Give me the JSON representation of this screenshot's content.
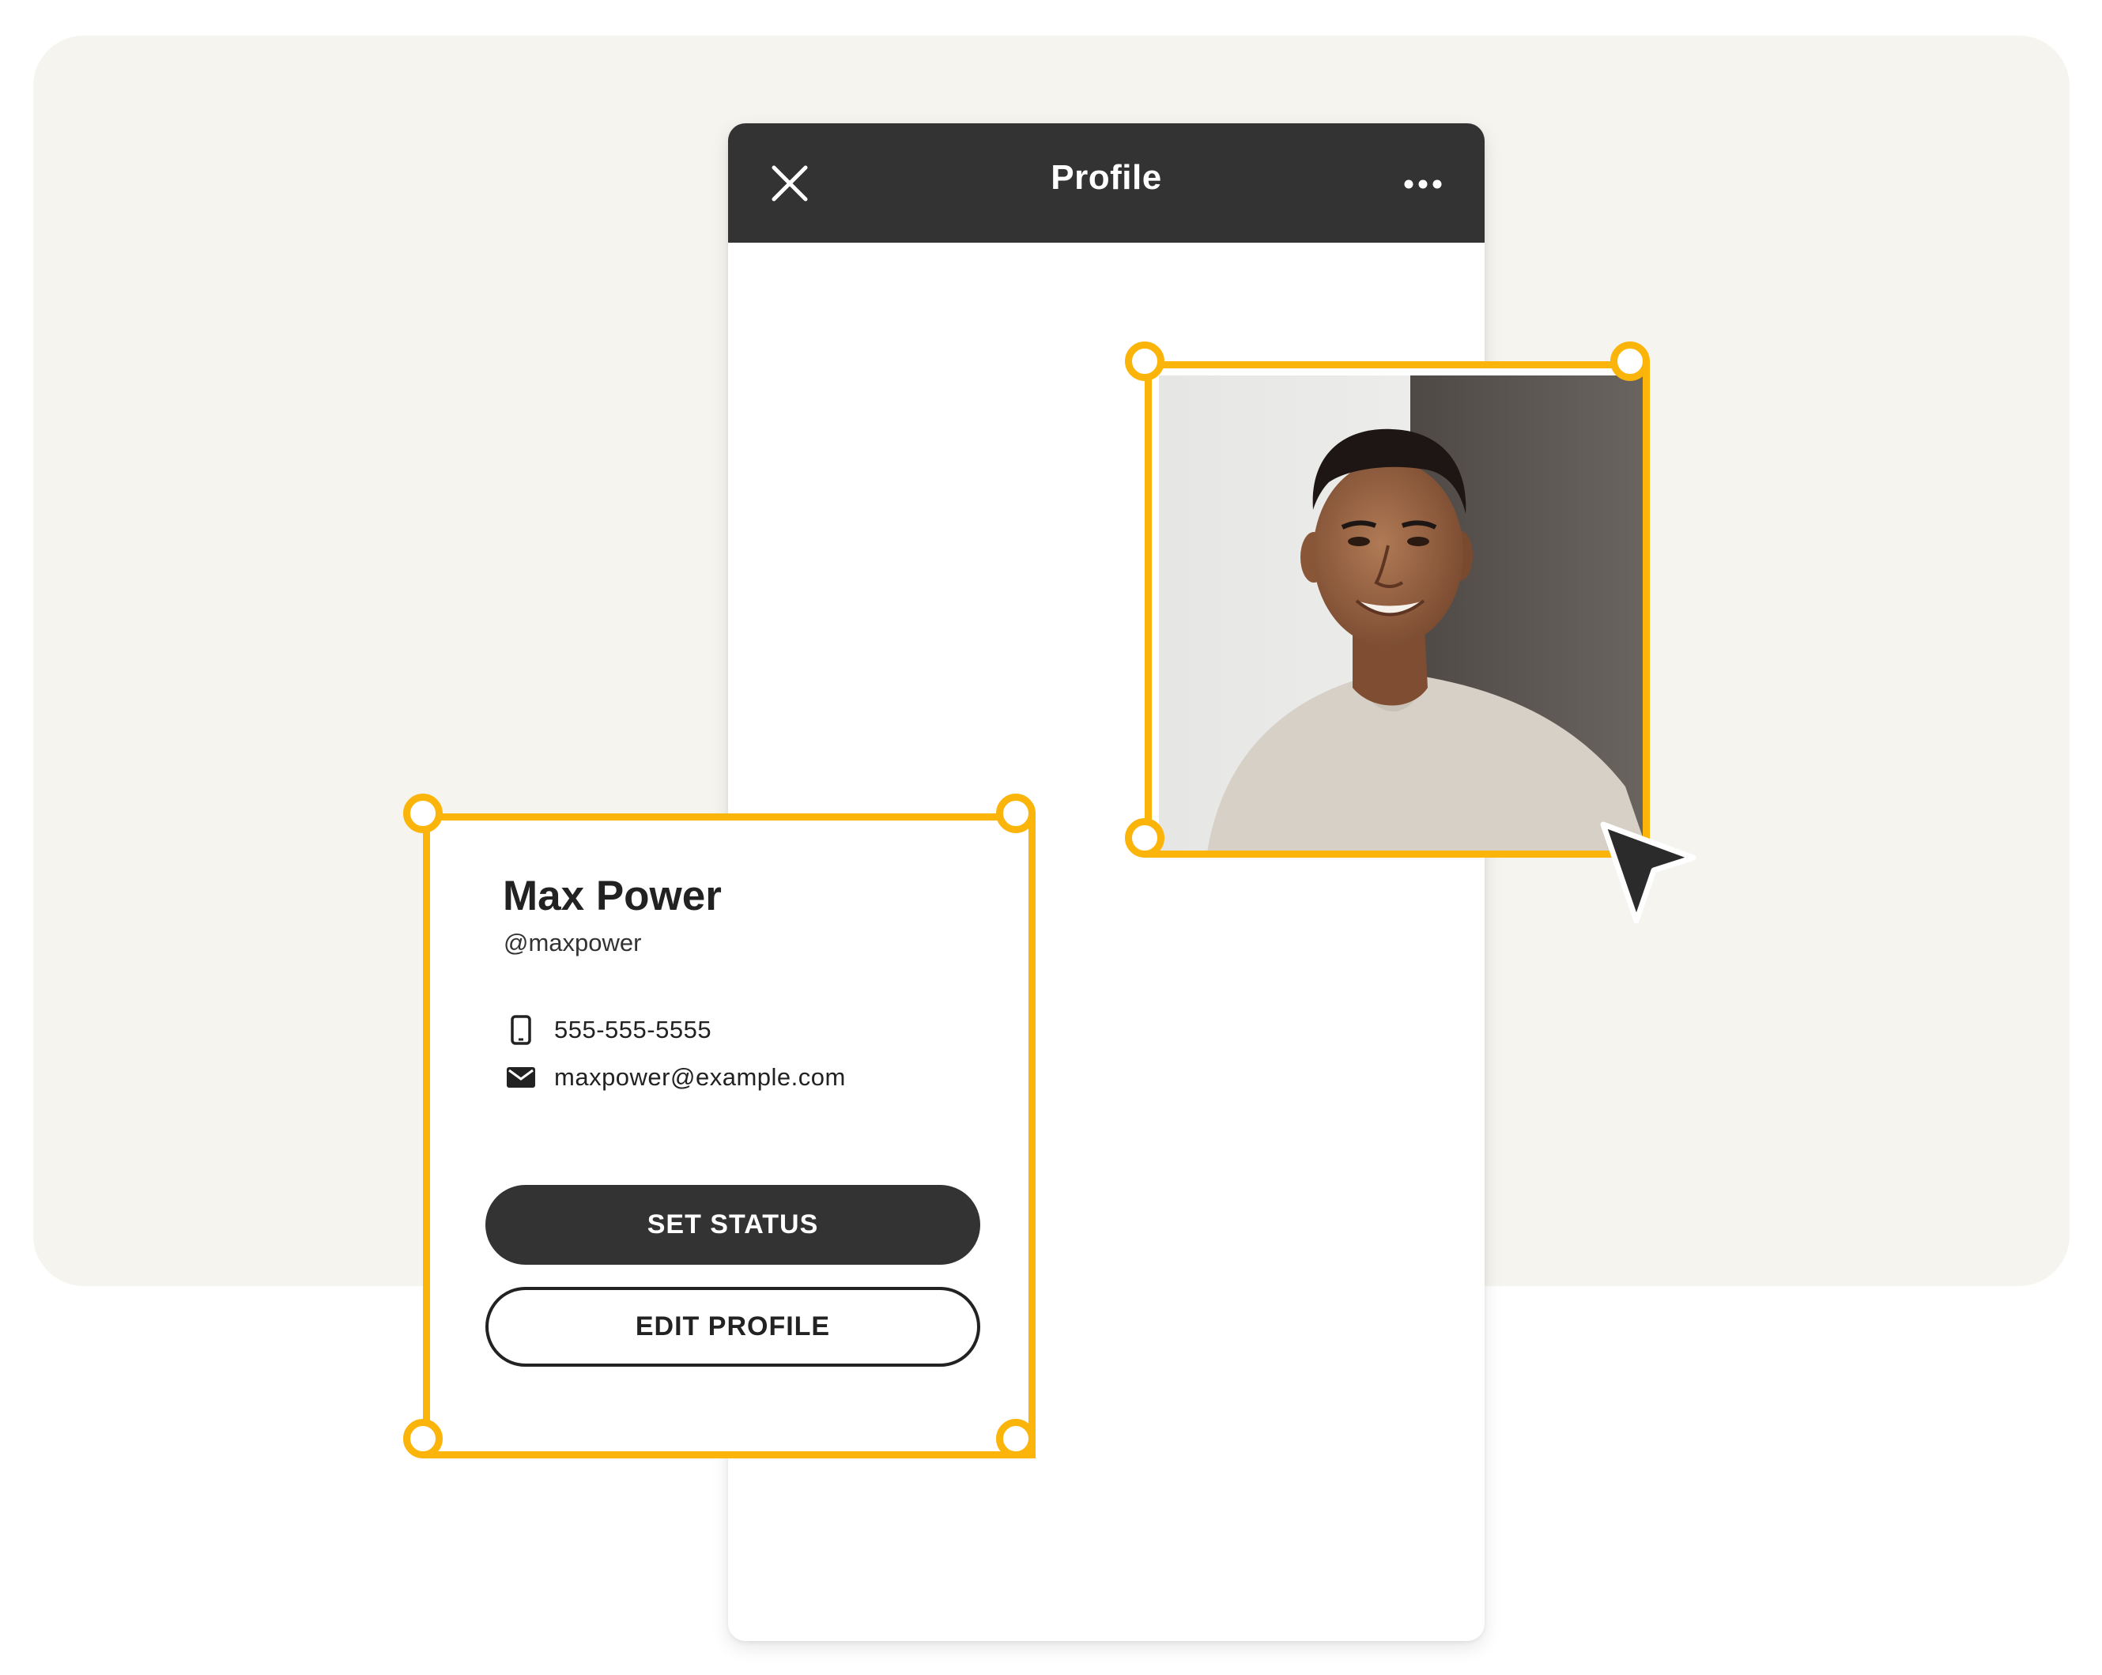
{
  "phone": {
    "title": "Profile",
    "close_icon": "close-icon",
    "more_icon": "more-horizontal-icon"
  },
  "profile_card": {
    "name": "Max Power",
    "handle": "@maxpower",
    "phone": "555-555-5555",
    "email": "maxpower@example.com",
    "phone_icon": "smartphone-icon",
    "email_icon": "mail-icon",
    "set_status_label": "SET STATUS",
    "edit_profile_label": "EDIT PROFILE"
  },
  "photo": {
    "description_icon": "profile-photo"
  },
  "colors": {
    "accent": "#fbb40a",
    "dark": "#333333",
    "backdrop": "#f6f4ef",
    "surface": "#ffffff"
  }
}
